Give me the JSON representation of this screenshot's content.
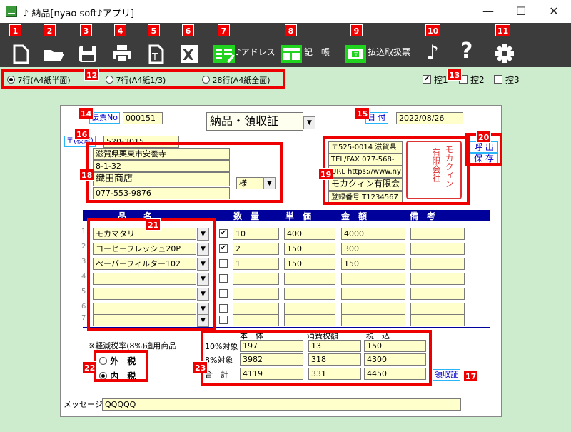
{
  "window": {
    "title": "♪ 納品[nyao soft♪アプリ]",
    "minimize": "—",
    "maximize": "☐",
    "close": "✕"
  },
  "badges": [
    "1",
    "2",
    "3",
    "4",
    "5",
    "6",
    "7",
    "8",
    "9",
    "10",
    "11",
    "12",
    "13",
    "14",
    "15",
    "16",
    "17",
    "18",
    "19",
    "20",
    "21",
    "22",
    "23"
  ],
  "toolbar": {
    "address_label": "♪アドレス",
    "ledger_label": "記　帳",
    "payment_label": "払込取扱票",
    "music_icon": "note-icon",
    "help_icon": "question-icon",
    "settings_icon": "gear-icon"
  },
  "options": {
    "layout_1": "7行(A4紙半面)",
    "layout_2": "7行(A4紙1/3)",
    "layout_3": "28行(A4紙全面)",
    "ctrl_1": "控1",
    "ctrl_2": "控2",
    "ctrl_3": "控3"
  },
  "form": {
    "denpyo_label": "伝票No",
    "denpyo_no": "000151",
    "doc_type": "納品・領収証",
    "date_label": "日 付",
    "date_value": "2022/08/26",
    "postal_search": "〒(検索)",
    "postal_code": "520-3015",
    "addr1": "滋賀県栗東市安養寺",
    "addr2": "8-1-32",
    "customer_name": "織田商店",
    "customer_tel": "077-553-9876",
    "honorific": "様",
    "sender_postal": "〒525-0014 滋賀県",
    "sender_tel": "TEL/FAX 077-568-",
    "sender_url": "URL https://www.ny",
    "sender_name": "モカクィン有限会",
    "sender_reg": "登録番号 T1234567",
    "seal_text_1": "モカクィン",
    "seal_text_2": "有限会社",
    "call_label": "呼 出",
    "save_label": "保 存",
    "receipt_label": "領収証",
    "message_label": "メッセージ",
    "message_value": "QQQQQ"
  },
  "table": {
    "headers": {
      "item": "品　　名",
      "qty": "数　量",
      "unit": "単　価",
      "amount": "金　額",
      "note": "備　考"
    },
    "rows": [
      {
        "num": "1",
        "name": "モカマタリ",
        "checked": "✔",
        "qty": "10",
        "unit": "400",
        "amount": "4000",
        "note": ""
      },
      {
        "num": "2",
        "name": "コーヒーフレッシュ20P",
        "checked": "✔",
        "qty": "2",
        "unit": "150",
        "amount": "300",
        "note": ""
      },
      {
        "num": "3",
        "name": "ペーパーフィルター102",
        "checked": "",
        "qty": "1",
        "unit": "150",
        "amount": "150",
        "note": ""
      },
      {
        "num": "4",
        "name": "",
        "checked": "",
        "qty": "",
        "unit": "",
        "amount": "",
        "note": ""
      },
      {
        "num": "5",
        "name": "",
        "checked": "",
        "qty": "",
        "unit": "",
        "amount": "",
        "note": ""
      },
      {
        "num": "6",
        "name": "",
        "checked": "",
        "qty": "",
        "unit": "",
        "amount": "",
        "note": ""
      },
      {
        "num": "7",
        "name": "",
        "checked": "",
        "qty": "",
        "unit": "",
        "amount": "",
        "note": ""
      }
    ]
  },
  "tax": {
    "reduced_note": "※軽減税率(8%)適用商品",
    "outer": "外　税",
    "inner": "内　税",
    "col_base": "本　体",
    "col_tax": "消費税額",
    "col_total": "税　込",
    "row10_label": "10%対象",
    "row8_label": "8%対象",
    "rowsum_label": "合　計",
    "r10_base": "197",
    "r10_tax": "13",
    "r10_total": "150",
    "r8_base": "3982",
    "r8_tax": "318",
    "r8_total": "4300",
    "sum_base": "4119",
    "sum_tax": "331",
    "sum_total": "4450"
  }
}
